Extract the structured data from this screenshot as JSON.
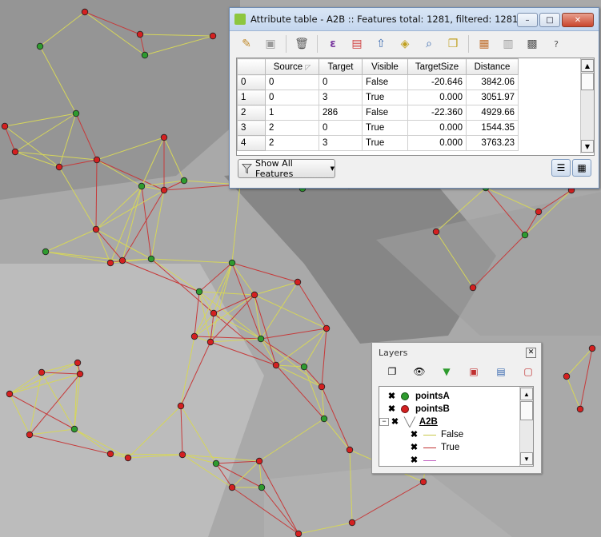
{
  "attribute_table": {
    "title": "Attribute table - A2B :: Features total: 1281, filtered: 1281, sel...",
    "toolbar_icons": [
      "edit-pencil-icon",
      "save-icon",
      "delete-icon",
      "expression-icon",
      "deselect-icon",
      "move-top-icon",
      "invert-selection-icon",
      "zoom-to-icon",
      "copy-icon",
      "delete-column-icon",
      "new-column-icon",
      "field-calculator-icon",
      "help-icon"
    ],
    "columns": [
      "Source",
      "Target",
      "Visible",
      "TargetSize",
      "Distance"
    ],
    "rows": [
      {
        "num": "0",
        "source": "0",
        "target": "0",
        "visible": "False",
        "target_size": "-20.646",
        "distance": "3842.06"
      },
      {
        "num": "1",
        "source": "0",
        "target": "3",
        "visible": "True",
        "target_size": "0.000",
        "distance": "3051.97"
      },
      {
        "num": "2",
        "source": "1",
        "target": "286",
        "visible": "False",
        "target_size": "-22.360",
        "distance": "4929.66"
      },
      {
        "num": "3",
        "source": "2",
        "target": "0",
        "visible": "True",
        "target_size": "0.000",
        "distance": "1544.35"
      },
      {
        "num": "4",
        "source": "2",
        "target": "3",
        "visible": "True",
        "target_size": "0.000",
        "distance": "3763.23"
      }
    ],
    "show_all_label": "Show All Features",
    "help_label": "?"
  },
  "layers": {
    "title": "Layers",
    "items": [
      {
        "name": "pointsA",
        "color": "#2e9b2e",
        "kind": "point"
      },
      {
        "name": "pointsB",
        "color": "#d42020",
        "kind": "point"
      },
      {
        "name": "A2B",
        "kind": "line"
      }
    ],
    "legend": [
      {
        "label": "False",
        "color": "#c8c84a"
      },
      {
        "label": "True",
        "color": "#c03030"
      },
      {
        "label": "",
        "color": "#c060c0"
      }
    ]
  },
  "colors": {
    "point_a": "#2e9b2e",
    "point_b": "#d42020",
    "line_false": "#d6d65a",
    "line_true": "#c63a3a"
  }
}
